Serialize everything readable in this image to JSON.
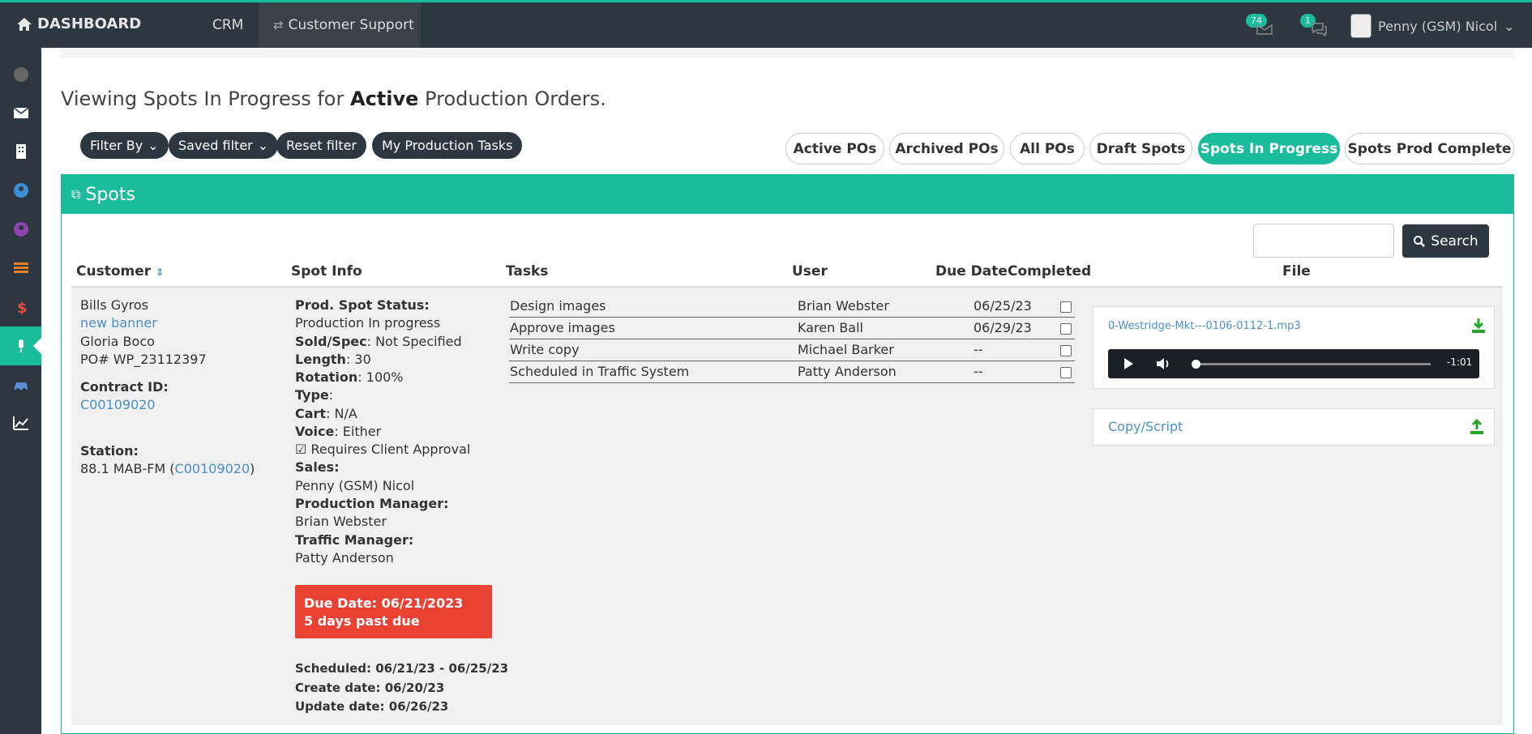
{
  "topbar": {
    "brand": "DASHBOARD",
    "crm": "CRM",
    "customer_support": "Customer Support",
    "mail_count": "74",
    "chat_count": "1",
    "user_name": "Penny (GSM) Nicol"
  },
  "heading": {
    "prefix": "Viewing Spots In Progress for ",
    "bold": "Active",
    "suffix": " Production Orders."
  },
  "filters": {
    "filter_by": "Filter By",
    "saved_filter": "Saved filter",
    "reset": "Reset filter",
    "my_tasks": "My Production Tasks"
  },
  "tabs": [
    {
      "label": "Active POs"
    },
    {
      "label": "Archived POs"
    },
    {
      "label": "All POs"
    },
    {
      "label": "Draft Spots"
    },
    {
      "label": "Spots In Progress"
    },
    {
      "label": "Spots Prod Complete"
    }
  ],
  "panel": {
    "title": "Spots",
    "search_label": "Search",
    "columns": [
      "Customer",
      "Spot Info",
      "Tasks",
      "User",
      "Due Date",
      "Completed",
      "File"
    ]
  },
  "customer": {
    "name": "Bills Gyros",
    "link": "new banner",
    "contact": "Gloria Boco",
    "po": "PO# WP_23112397",
    "contract_label": "Contract ID:",
    "contract_id": "C00109020",
    "station_label": "Station:",
    "station_prefix": "88.1 MAB-FM (",
    "station_link": "C00109020",
    "station_suffix": ")"
  },
  "spot_info": {
    "status_label": "Prod. Spot Status:",
    "status_value": "Production In progress",
    "sold_label": "Sold/Spec",
    "sold_value": ": Not Specified",
    "length_label": "Length",
    "length_value": ": 30",
    "rotation_label": "Rotation",
    "rotation_value": ": 100%",
    "type_label": "Type",
    "type_value": ":",
    "cart_label": "Cart",
    "cart_value": ": N/A",
    "voice_label": "Voice",
    "voice_value": ": Either",
    "approval": "Requires Client Approval",
    "sales_label": "Sales:",
    "sales_value": "Penny (GSM) Nicol",
    "pm_label": "Production Manager:",
    "pm_value": "Brian Webster",
    "tm_label": "Traffic Manager:",
    "tm_value": "Patty Anderson",
    "due_line1": "Due Date: 06/21/2023",
    "due_line2": "5 days past due",
    "scheduled": "Scheduled: 06/21/23 - 06/25/23",
    "created": "Create date: 06/20/23",
    "updated": "Update date: 06/26/23"
  },
  "tasks": [
    {
      "task": "Design images",
      "user": "Brian Webster",
      "due": "06/25/23"
    },
    {
      "task": "Approve images",
      "user": "Karen Ball",
      "due": "06/29/23"
    },
    {
      "task": "Write copy",
      "user": "Michael Barker",
      "due": "--"
    },
    {
      "task": "Scheduled in Traffic System",
      "user": "Patty Anderson",
      "due": "--"
    }
  ],
  "files": {
    "audio_name": "0-Westridge-Mkt---0106-0112-1.mp3",
    "audio_time": "-1:01",
    "script_label": "Copy/Script"
  },
  "colors": {
    "accent": "#1abc9c",
    "dark": "#2d3740",
    "danger": "#e84234",
    "link": "#4a90c8"
  }
}
